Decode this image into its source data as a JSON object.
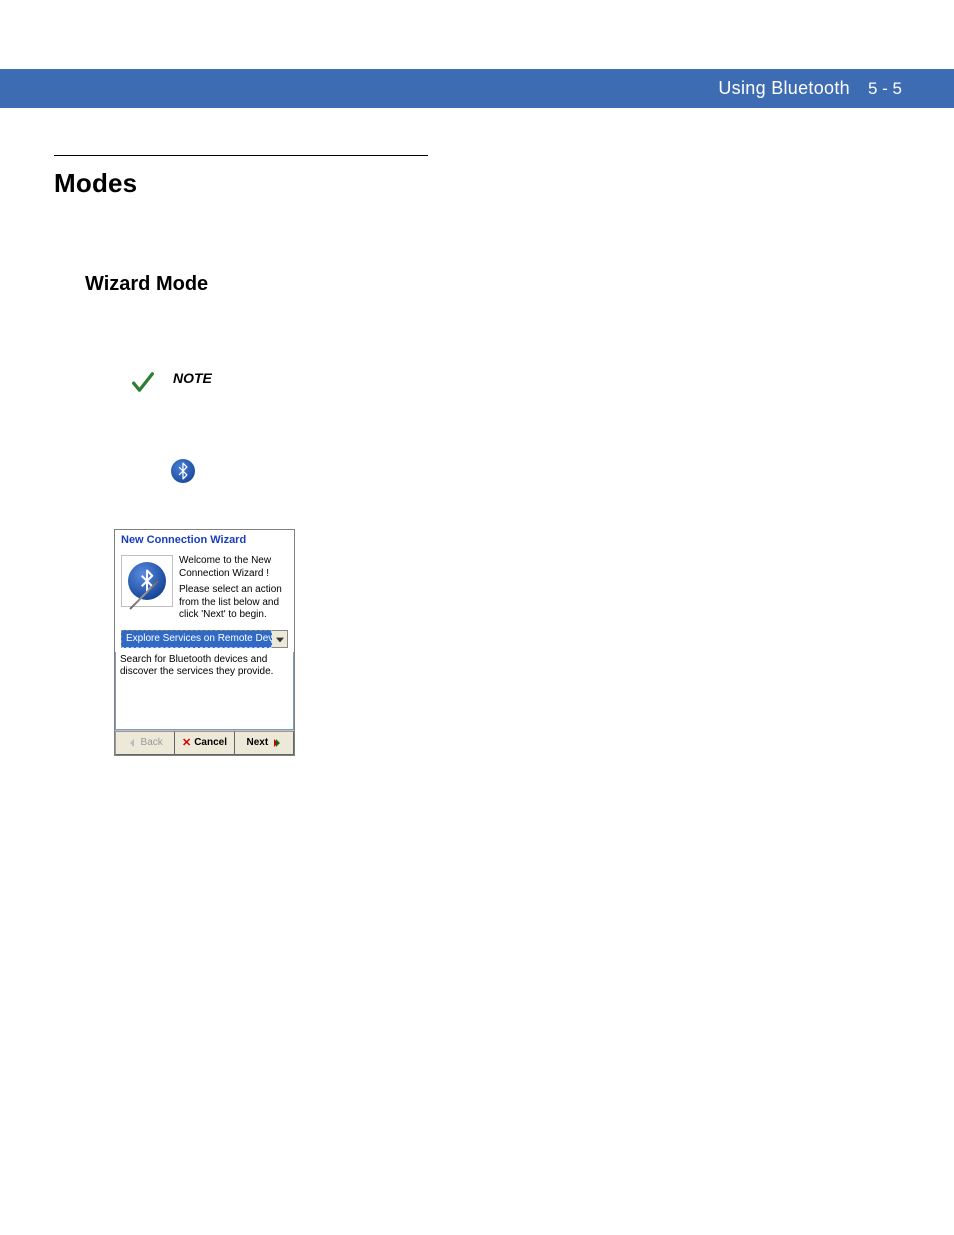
{
  "header": {
    "title": "Using Bluetooth",
    "page": "5 - 5"
  },
  "section": {
    "title": "Modes",
    "subsection": "Wizard Mode"
  },
  "note": {
    "label": "NOTE"
  },
  "icons": {
    "checkmark": "checkmark-icon",
    "bluetooth": "bluetooth-icon"
  },
  "wizard": {
    "title": "New Connection Wizard",
    "welcome": "Welcome to the New Connection Wizard !",
    "instruction": "Please select an action from the list below and click 'Next' to begin.",
    "selected_option": "Explore Services on Remote Device",
    "description": "Search for Bluetooth devices and discover the services they provide.",
    "buttons": {
      "back": "Back",
      "cancel": "Cancel",
      "next": "Next"
    }
  }
}
